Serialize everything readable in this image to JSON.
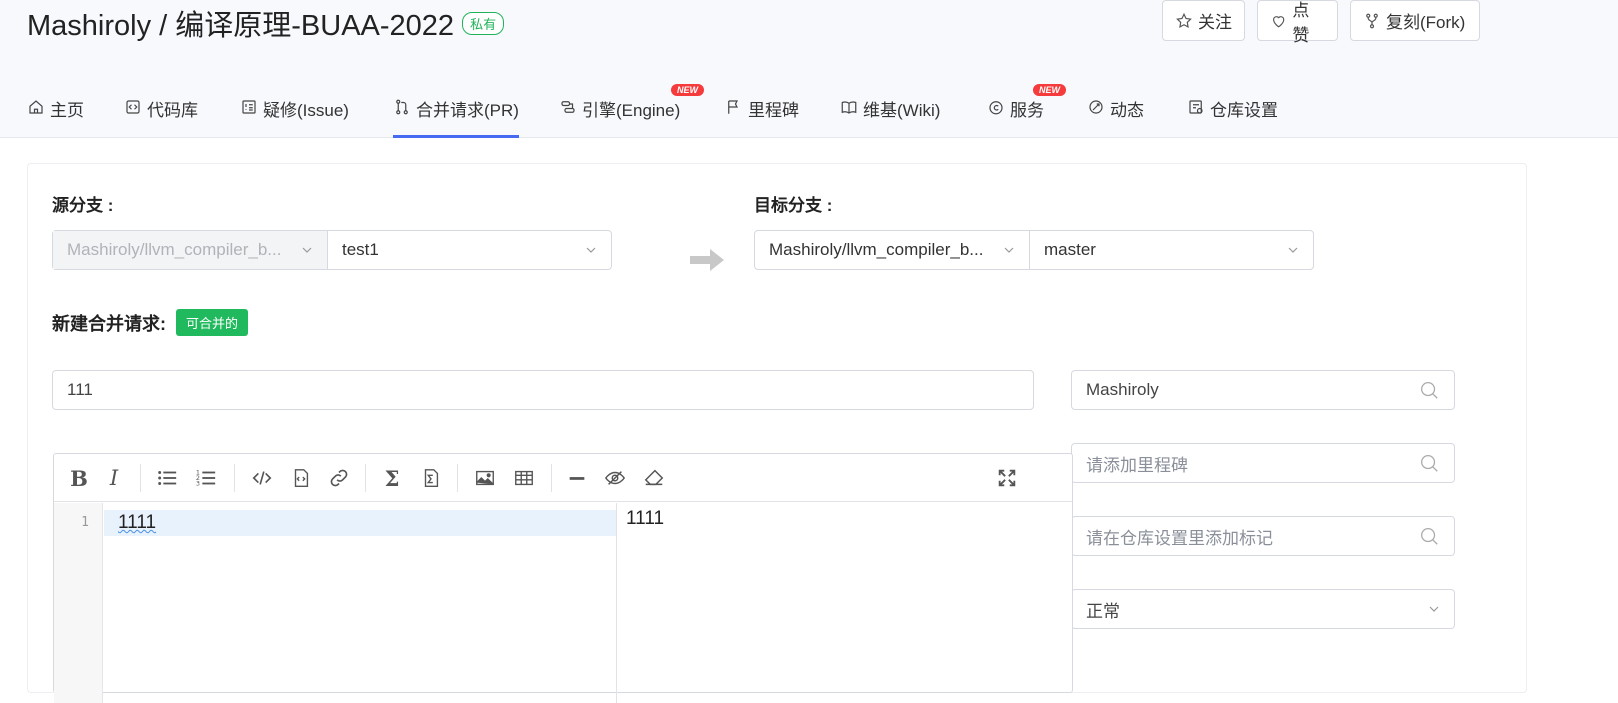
{
  "header": {
    "owner_repo": "Mashiroly / 编译原理-BUAA-2022",
    "visibility_badge": "私有",
    "buttons": [
      {
        "label": "关注",
        "icon": "star-icon"
      },
      {
        "label": "点赞",
        "icon": "heart-icon"
      },
      {
        "label": "复刻(Fork)",
        "icon": "fork-icon"
      }
    ]
  },
  "nav": {
    "items": [
      {
        "label": "主页",
        "icon": "home-icon"
      },
      {
        "label": "代码库",
        "icon": "code-icon"
      },
      {
        "label": "疑修(Issue)",
        "icon": "issue-icon"
      },
      {
        "label": "合并请求(PR)",
        "icon": "pull-request-icon",
        "active": true
      },
      {
        "label": "引擎(Engine)",
        "icon": "engine-icon",
        "badge": "NEW"
      },
      {
        "label": "里程碑",
        "icon": "flag-icon"
      },
      {
        "label": "维基(Wiki)",
        "icon": "book-icon"
      },
      {
        "label": "服务",
        "icon": "service-icon",
        "badge": "NEW"
      },
      {
        "label": "动态",
        "icon": "activity-icon"
      },
      {
        "label": "仓库设置",
        "icon": "settings-icon"
      }
    ]
  },
  "form": {
    "source_label": "源分支 :",
    "source_repo": "Mashiroly/llvm_compiler_b...",
    "source_branch": "test1",
    "target_label": "目标分支 :",
    "target_repo": "Mashiroly/llvm_compiler_b...",
    "target_branch": "master",
    "new_pr_label": "新建合并请求:",
    "mergeable_badge": "可合并的",
    "title_value": "111",
    "assignee_value": "Mashiroly",
    "milestone_placeholder": "请添加里程碑",
    "tag_placeholder": "请在仓库设置里添加标记",
    "priority_value": "正常"
  },
  "editor": {
    "line_number": "1",
    "content": "1111",
    "preview": "1111",
    "tools": [
      "bold",
      "italic",
      "bullet-list",
      "ordered-list",
      "code",
      "code-block",
      "link",
      "sigma",
      "formula",
      "image",
      "table",
      "horizontal-rule",
      "preview-toggle",
      "eraser",
      "fullscreen"
    ]
  },
  "colors": {
    "accent": "#466af0",
    "success": "#21b95d",
    "new_badge": "#f53b3b"
  }
}
